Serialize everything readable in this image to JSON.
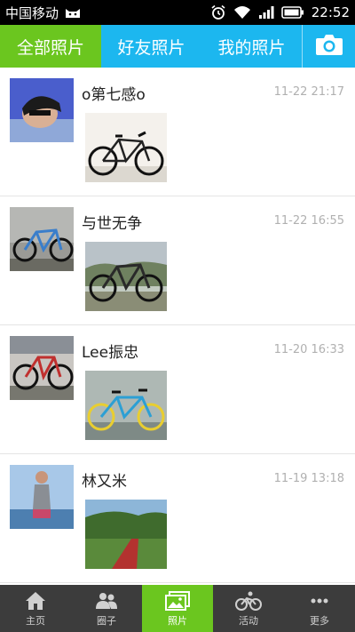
{
  "status_bar": {
    "carrier": "中国移动",
    "time": "22:52",
    "icons": [
      "cat-icon",
      "alarm-icon",
      "wifi-icon",
      "signal-icon",
      "battery-icon"
    ]
  },
  "tabs": [
    {
      "label": "全部照片",
      "active": true
    },
    {
      "label": "好友照片",
      "active": false
    },
    {
      "label": "我的照片",
      "active": false
    }
  ],
  "camera_icon": "camera-icon",
  "posts": [
    {
      "user": "o第七感o",
      "time": "11-22 21:17"
    },
    {
      "user": "与世无争",
      "time": "11-22 16:55"
    },
    {
      "user": "Lee振忠",
      "time": "11-20 16:33"
    },
    {
      "user": "林又米",
      "time": "11-19 13:18"
    }
  ],
  "bottom_nav": [
    {
      "label": "主页",
      "icon": "home-icon",
      "active": false
    },
    {
      "label": "圈子",
      "icon": "people-icon",
      "active": false
    },
    {
      "label": "照片",
      "icon": "photos-icon",
      "active": true
    },
    {
      "label": "活动",
      "icon": "cyclist-icon",
      "active": false
    },
    {
      "label": "更多",
      "icon": "more-icon",
      "active": false
    }
  ],
  "colors": {
    "tab_bar": "#1cb7ef",
    "accent_green": "#6bc61f",
    "bottom_nav": "#3c3c3c",
    "time_text": "#b0b0b0"
  }
}
